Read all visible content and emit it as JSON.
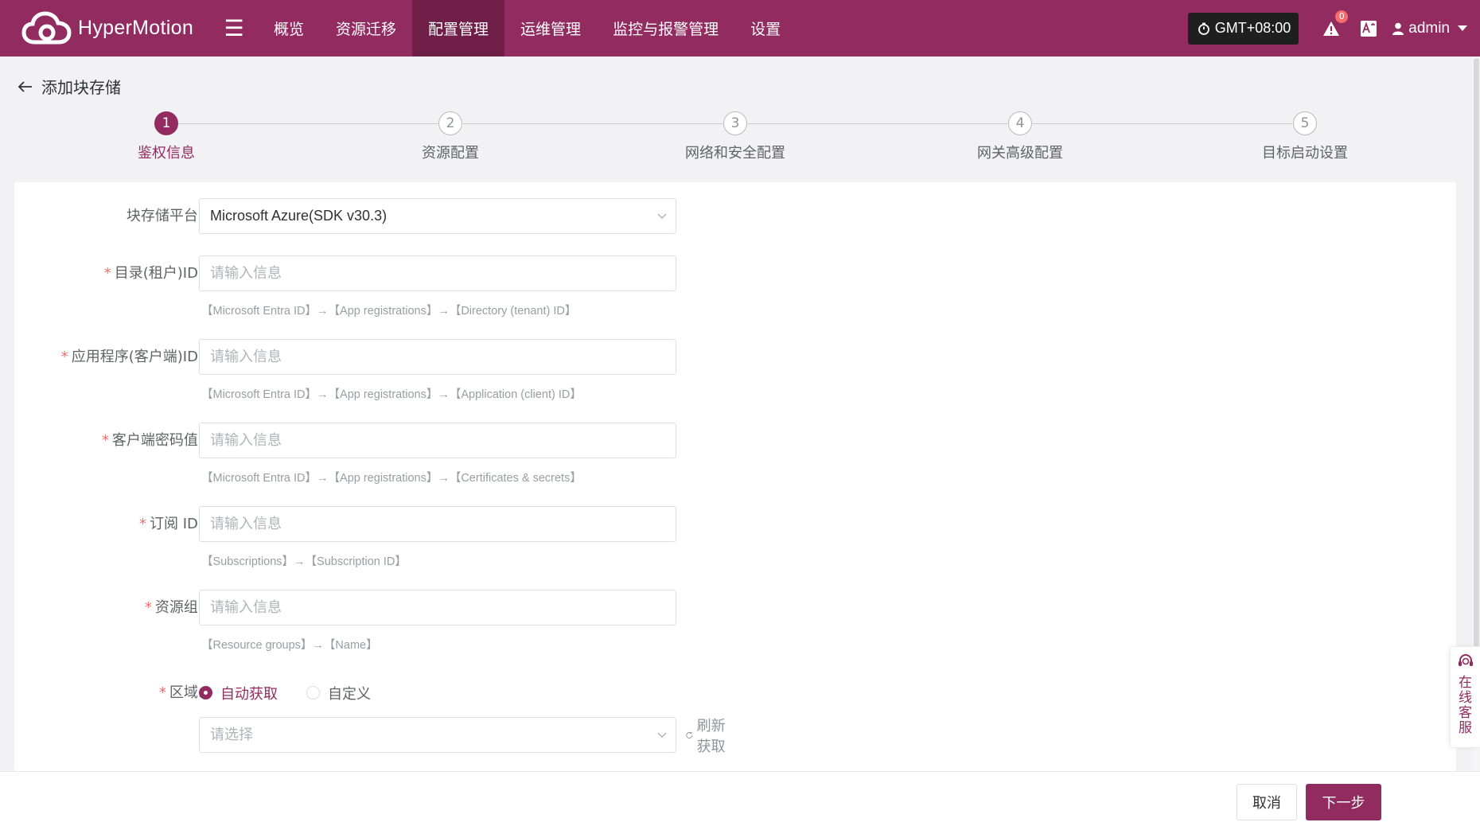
{
  "app": {
    "name": "HyperMotion",
    "menu_icon": "hamburger-icon"
  },
  "nav": {
    "items": [
      {
        "label": "概览",
        "active": false
      },
      {
        "label": "资源迁移",
        "active": false
      },
      {
        "label": "配置管理",
        "active": true
      },
      {
        "label": "运维管理",
        "active": false
      },
      {
        "label": "监控与报警管理",
        "active": false
      },
      {
        "label": "设置",
        "active": false
      }
    ]
  },
  "topbar": {
    "timezone": "GMT+08:00",
    "alert_count": "0",
    "user": "admin"
  },
  "page": {
    "title": "添加块存储"
  },
  "steps": [
    {
      "number": "1",
      "label": "鉴权信息",
      "active": true
    },
    {
      "number": "2",
      "label": "资源配置",
      "active": false
    },
    {
      "number": "3",
      "label": "网络和安全配置",
      "active": false
    },
    {
      "number": "4",
      "label": "网关高级配置",
      "active": false
    },
    {
      "number": "5",
      "label": "目标启动设置",
      "active": false
    }
  ],
  "form": {
    "platform": {
      "label": "块存储平台:",
      "value": "Microsoft Azure(SDK v30.3)"
    },
    "tenant_id": {
      "label": "目录(租户)ID:",
      "placeholder": "请输入信息",
      "hint": "【Microsoft Entra ID】→【App registrations】→【Directory (tenant) ID】"
    },
    "client_id": {
      "label": "应用程序(客户端)ID:",
      "placeholder": "请输入信息",
      "hint": "【Microsoft Entra ID】→【App registrations】→【Application (client) ID】"
    },
    "client_secret": {
      "label": "客户端密码值:",
      "placeholder": "请输入信息",
      "hint": "【Microsoft Entra ID】→【App registrations】→【Certificates & secrets】"
    },
    "subscription_id": {
      "label": "订阅 ID:",
      "placeholder": "请输入信息",
      "hint": "【Subscriptions】→【Subscription ID】"
    },
    "resource_group": {
      "label": "资源组:",
      "placeholder": "请输入信息",
      "hint": "【Resource groups】→【Name】"
    },
    "region": {
      "label": "区域:",
      "options": [
        {
          "label": "自动获取",
          "checked": true
        },
        {
          "label": "自定义",
          "checked": false
        }
      ],
      "select_placeholder": "请选择",
      "refresh_label": "刷新获取"
    },
    "required_mark": "*"
  },
  "footer": {
    "cancel_label": "取消",
    "next_label": "下一步"
  },
  "service": {
    "label": "在线客服"
  },
  "colors": {
    "brand": "#922b5f",
    "brand_dark": "#6f1e47",
    "required": "#f56c6c"
  }
}
